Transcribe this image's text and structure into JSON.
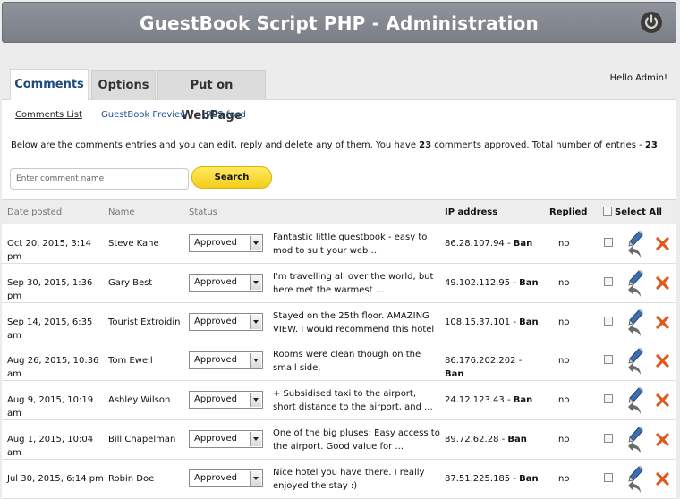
{
  "header": {
    "title": "GuestBook Script PHP - Administration"
  },
  "tabs": [
    "Comments",
    "Options",
    "Put on WebPage"
  ],
  "greeting": "Hello Admin!",
  "subnav": [
    "Comments List",
    "GuestBook Preview",
    "RSS feed"
  ],
  "info": {
    "text_before": "Below are the comments entries and you can edit, reply and delete any of them. You have ",
    "approved": "23",
    "text_middle": " comments approved. Total number of entries - ",
    "total": "23",
    "text_end": "."
  },
  "search": {
    "placeholder": "Enter comment name",
    "button": "Search"
  },
  "columns": {
    "date": "Date posted",
    "name": "Name",
    "status": "Status",
    "ip": "IP address",
    "replied": "Replied",
    "select_all": "Select All"
  },
  "ban_label": "Ban",
  "rows": [
    {
      "date": "Oct 20, 2015, 3:14 pm",
      "name": "Steve Kane",
      "status": "Approved",
      "comment": "Fantastic little guestbook - easy to mod to suit your web ...",
      "ip": "86.28.107.94",
      "replied": "no"
    },
    {
      "date": "Sep 30, 2015, 1:36 pm",
      "name": "Gary Best",
      "status": "Approved",
      "comment": "I'm travelling all over the world, but here met the warmest ...",
      "ip": "49.102.112.95",
      "replied": "no"
    },
    {
      "date": "Sep 14, 2015, 6:35 am",
      "name": "Tourist Extroidin",
      "status": "Approved",
      "comment": "Stayed on the 25th floor. AMAZING VIEW. I would recommend this hotel ...",
      "ip": "108.15.37.101",
      "replied": "no"
    },
    {
      "date": "Aug 26, 2015, 10:36 am",
      "name": "Tom Ewell",
      "status": "Approved",
      "comment": "Rooms were clean though on the small side.",
      "ip": "86.176.202.202",
      "replied": "no"
    },
    {
      "date": "Aug 9, 2015, 10:19 am",
      "name": "Ashley Wilson",
      "status": "Approved",
      "comment": "+ Subsidised taxi to the airport, short distance to the airport, and ...",
      "ip": "24.12.123.43",
      "replied": "no"
    },
    {
      "date": "Aug 1, 2015, 10:04 am",
      "name": "Bill Chapelman",
      "status": "Approved",
      "comment": "One of the big pluses: Easy access to the airport. Good value for ...",
      "ip": "89.72.62.28",
      "replied": "no"
    },
    {
      "date": "Jul 30, 2015, 6:14 pm",
      "name": "Robin Doe",
      "status": "Approved",
      "comment": "Nice hotel you have there. I really enjoyed the stay :)",
      "ip": "87.51.225.185",
      "replied": "no"
    }
  ],
  "icons": {
    "power": "power-icon",
    "edit": "edit-pen-icon",
    "reply": "reply-arrow-icon",
    "delete": "delete-x-icon"
  },
  "colors": {
    "header": "#858991",
    "link": "#1a4f8a",
    "search_button": "#f7d52a",
    "delete": "#e2571b"
  }
}
